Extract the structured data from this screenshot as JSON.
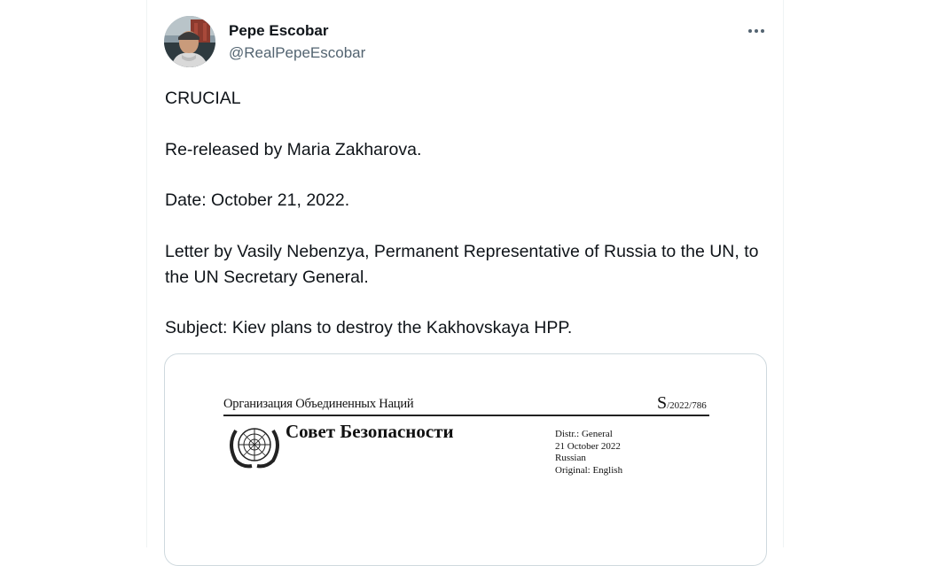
{
  "author": {
    "name": "Pepe Escobar",
    "handle": "@RealPepeEscobar",
    "avatar_icon": "profile-photo"
  },
  "menu": {
    "more_icon": "more-horizontal-icon"
  },
  "tweet": {
    "paragraphs": [
      "CRUCIAL",
      "Re-released by Maria Zakharova.",
      "Date: October 21, 2022.",
      "Letter by Vasily Nebenzya, Permanent Representative of Russia to the UN, to the UN Secretary General.",
      "Subject:  Kiev plans to destroy the Kakhovskaya HPP."
    ]
  },
  "media": {
    "document": {
      "organization": "Организация Объединенных Наций",
      "symbol_prefix": "S",
      "symbol_number": "/2022/786",
      "council": "Совет Безопасности",
      "distribution": "Distr.: General",
      "date": "21 October 2022",
      "language": "Russian",
      "original": "Original: English",
      "emblem_icon": "un-emblem-icon"
    }
  },
  "colors": {
    "text_primary": "#0f1419",
    "text_secondary": "#536471",
    "border": "#cfd9de"
  }
}
